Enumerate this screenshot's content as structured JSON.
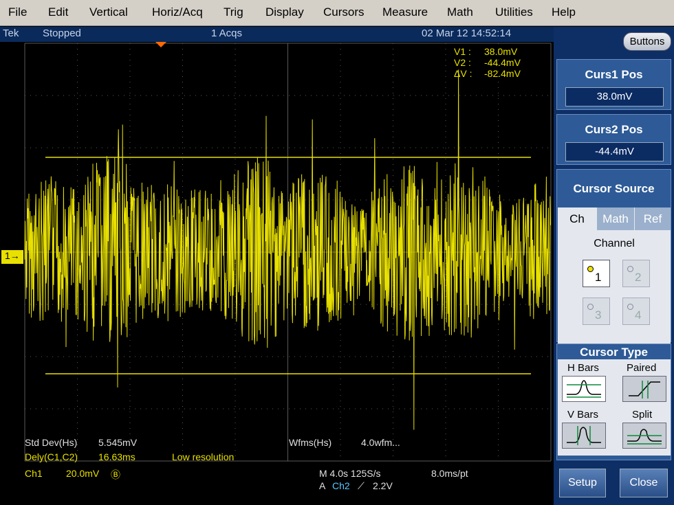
{
  "menu": [
    "File",
    "Edit",
    "Vertical",
    "Horiz/Acq",
    "Trig",
    "Display",
    "Cursors",
    "Measure",
    "Math",
    "Utilities",
    "Help"
  ],
  "status": {
    "brand": "Tek",
    "state": "Stopped",
    "acqs": "1 Acqs",
    "datetime": "02 Mar 12 14:52:14"
  },
  "cursor_readout": {
    "v1_label": "V1 :",
    "v1_value": "38.0mV",
    "v2_label": "V2 :",
    "v2_value": "-44.4mV",
    "dv_label": "ΔV :",
    "dv_value": "-82.4mV"
  },
  "channel_marker": "1→",
  "measurements": {
    "m1_label": "Std Dev(Hs)",
    "m1_value": "5.545mV",
    "m2_label": "Dely(C1,C2)",
    "m2_value": "16.63ms",
    "m2_note": "Low resolution",
    "m3_label": "Wfms(Hs)",
    "m3_value": "4.0wfm..."
  },
  "bottom": {
    "ch1_label": "Ch1",
    "ch1_scale": "20.0mV",
    "ch1_bw": "Ⓑ",
    "horiz": "M 4.0s 125S/s",
    "res": "8.0ms/pt",
    "trig_prefix": "A",
    "trig_source": "Ch2",
    "trig_slope": "⟋",
    "trig_level": "2.2V"
  },
  "panel": {
    "buttons_label": "Buttons",
    "curs1_title": "Curs1 Pos",
    "curs1_value": "38.0mV",
    "curs2_title": "Curs2 Pos",
    "curs2_value": "-44.4mV",
    "source_title": "Cursor Source",
    "tabs": [
      "Ch",
      "Math",
      "Ref"
    ],
    "channel_label": "Channel",
    "channels": [
      "1",
      "2",
      "3",
      "4"
    ],
    "type_title": "Cursor Type",
    "types": [
      "H Bars",
      "Paired",
      "V Bars",
      "Split"
    ],
    "setup_label": "Setup",
    "close_label": "Close"
  },
  "colors": {
    "trace": "#e8e000",
    "panel": "#0e2f66",
    "status": "#0a2a5c"
  }
}
